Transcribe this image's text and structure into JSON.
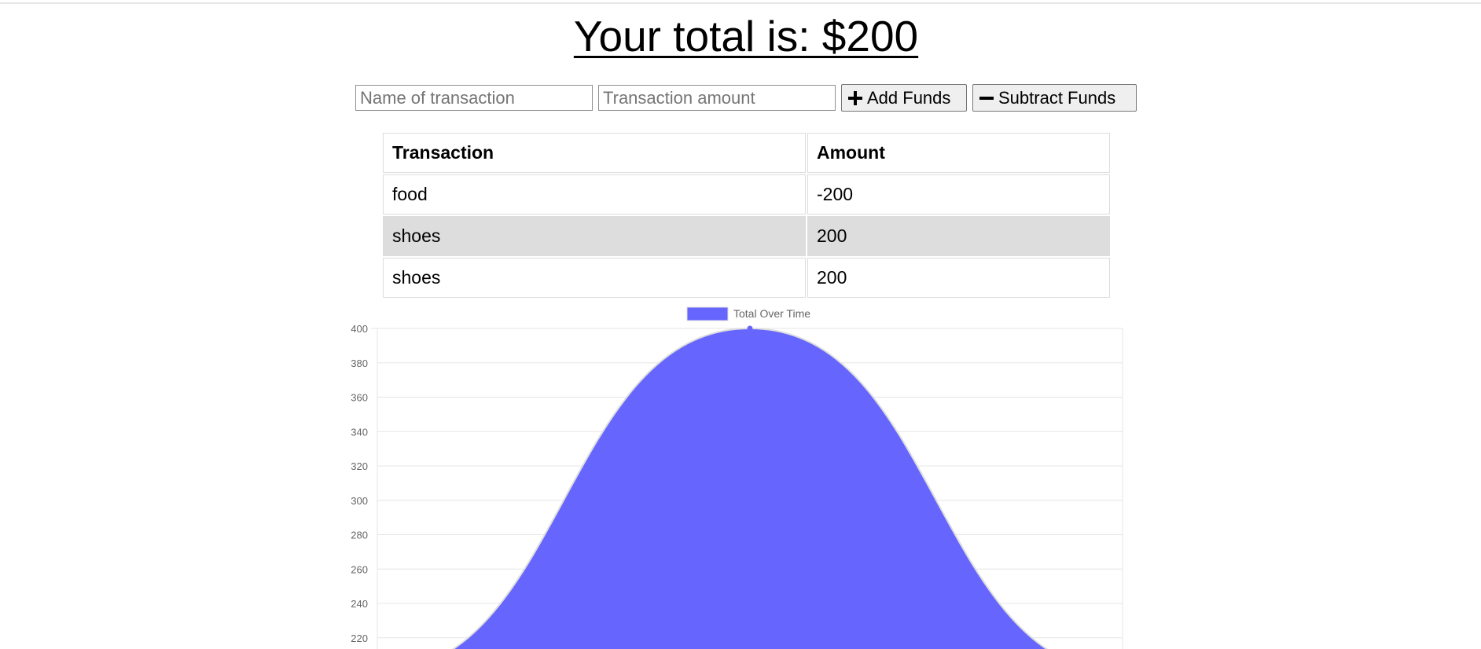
{
  "header": {
    "total_text": "Your total is: $200"
  },
  "form": {
    "name_placeholder": "Name of transaction",
    "amount_placeholder": "Transaction amount",
    "add_label": "Add Funds",
    "subtract_label": "Subtract Funds",
    "add_icon": "plus-icon",
    "subtract_icon": "minus-icon"
  },
  "table": {
    "headers": [
      "Transaction",
      "Amount"
    ],
    "rows": [
      {
        "name": "food",
        "amount": "-200"
      },
      {
        "name": "shoes",
        "amount": "200"
      },
      {
        "name": "shoes",
        "amount": "200"
      }
    ]
  },
  "chart_data": {
    "type": "area",
    "legend": "Total Over Time",
    "legend_placement": "top-center",
    "series": [
      {
        "name": "Total Over Time",
        "values": [
          200,
          400,
          200
        ]
      }
    ],
    "yticks": [
      220,
      240,
      260,
      280,
      300,
      320,
      340,
      360,
      380,
      400
    ],
    "ylim": [
      0,
      400
    ],
    "grid": true,
    "colors": {
      "fill": "#6666ff",
      "line": "#dddddd",
      "grid": "#e5e5e5",
      "tick_text": "#666666"
    }
  }
}
